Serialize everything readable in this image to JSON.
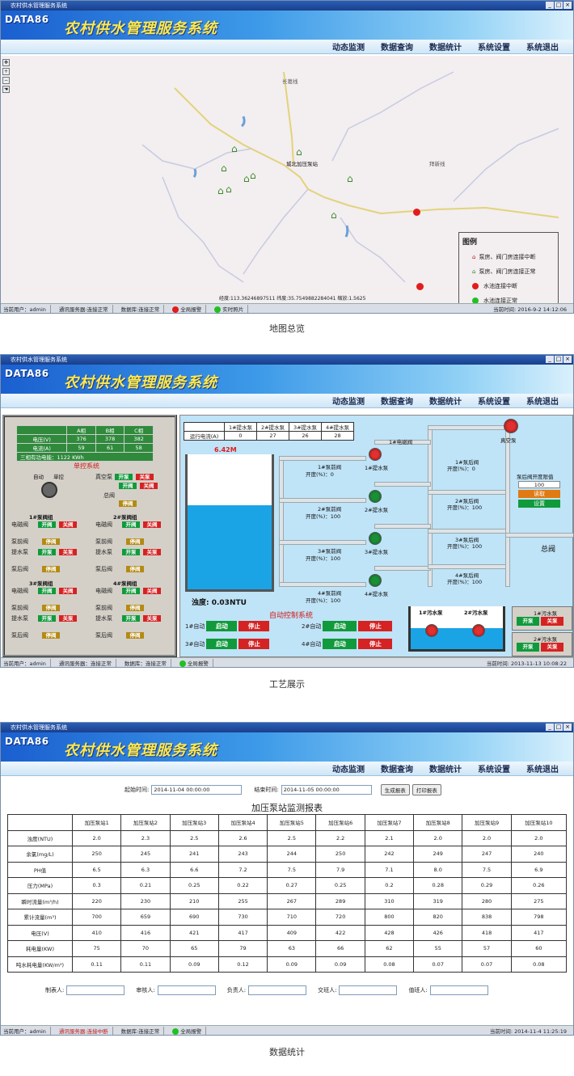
{
  "app": {
    "title": "农村供水管理服务系统",
    "brand": "农村供水管理服务系统",
    "logo": "DATA86",
    "window_title": "农村供水管理服务系统"
  },
  "menu": [
    "动态监测",
    "数据查询",
    "数据统计",
    "系统设置",
    "系统退出"
  ],
  "map": {
    "road_labels": [
      "长葛线",
      "城北加压泵站",
      "拜新线"
    ],
    "legend_title": "图例",
    "legend_items": [
      "泵房、阀门房连接中断",
      "泵房、阀门房连接正常",
      "水池连接中断",
      "水池连接正常"
    ],
    "coords": "经度:113.36246897511 纬度:35.7549882284041 缩放:1.5625",
    "status": {
      "user": "当前用户：admin",
      "comm": "通讯服务器:连接正常",
      "db": "数据库:连接正常",
      "alarm": "全局报警",
      "photo": "实时照片",
      "time": "当前时间: 2016-9-2 14:12:06"
    }
  },
  "map_caption": "地图总览",
  "process": {
    "power_table": {
      "headers": [
        "",
        "A相",
        "B相",
        "C相"
      ],
      "rows": [
        [
          "电压(V)",
          "376",
          "378",
          "382"
        ],
        [
          "电流(A)",
          "59",
          "61",
          "58"
        ]
      ],
      "footer": "三相有功电能：1122 KWh"
    },
    "single_title": "单控系统",
    "auto": "自动",
    "single": "单控",
    "vacuum": "真空泵",
    "total_valve": "总阀",
    "groups": [
      {
        "title": "1#泵阀组",
        "rows": [
          "电磁阀",
          "泵前阀",
          "提水泵",
          "泵后阀"
        ]
      },
      {
        "title": "2#泵阀组",
        "rows": [
          "电磁阀",
          "泵前阀",
          "提水泵",
          "泵后阀"
        ]
      },
      {
        "title": "3#泵阀组",
        "rows": [
          "电磁阀",
          "泵前阀",
          "提水泵",
          "泵后阀"
        ]
      },
      {
        "title": "4#泵阀组",
        "rows": [
          "电磁阀",
          "泵前阀",
          "提水泵",
          "泵后阀"
        ]
      }
    ],
    "btn_open": "开阀",
    "btn_close": "关阀",
    "btn_pump_open": "开泵",
    "btn_pump_close": "关泵",
    "btn_stop": "停阀",
    "current_table": {
      "headers": [
        "",
        "1#提水泵",
        "2#提水泵",
        "3#提水泵",
        "4#提水泵"
      ],
      "row_label": "运行电流(A)",
      "values": [
        "0",
        "27",
        "26",
        "28"
      ]
    },
    "tank_level": "6.42M",
    "tank_level_pct": 0.62,
    "turbidity": "浊度: 0.03NTU",
    "auto_control_title": "自动控制系统",
    "auto_groups": [
      "1#自动",
      "2#自动",
      "3#自动",
      "4#自动"
    ],
    "btn_start": "启动",
    "btn_halt": "停止",
    "pump_labels": [
      "1#提水泵",
      "2#提水泵",
      "3#提水泵",
      "4#提水泵"
    ],
    "valve_labels": [
      "1#泵前阀",
      "2#泵前阀",
      "3#泵前阀",
      "4#泵前阀",
      "1#泵后阀",
      "2#泵后阀",
      "3#泵后阀",
      "4#泵后阀",
      "1#电磁阀"
    ],
    "open_pct": [
      "开度(%)：0",
      "开度(%)：100",
      "开度(%)：100",
      "开度(%)：100",
      "开度(%)：0",
      "开度(%)：100",
      "开度(%)：100",
      "开度(%)：100"
    ],
    "vacuum_pump": "真空泵",
    "rear_valve_title": "泵后阀开度限值",
    "rear_value": "100",
    "btn_read": "读取",
    "btn_set": "设置",
    "main_valve": "总阀",
    "sewage": [
      "1#污水泵",
      "2#污水泵"
    ],
    "sewage_ctrl": [
      "1#污水泵",
      "2#污水泵"
    ],
    "status": {
      "user": "当前用户：admin",
      "comm": "通讯服务器：连接正常",
      "db": "数据库：连接正常",
      "alarm": "全局报警",
      "time": "当前时间: 2013-11-13 10:08:22"
    }
  },
  "process_caption": "工艺展示",
  "report": {
    "start_label": "起始时间:",
    "start_value": "2014-11-04 00:00:00",
    "end_label": "结束时间:",
    "end_value": "2014-11-05 00:00:00",
    "btn_generate": "生成报表",
    "btn_print": "打印报表",
    "title": "加压泵站监测报表",
    "columns": [
      "",
      "加压泵站1",
      "加压泵站2",
      "加压泵站3",
      "加压泵站4",
      "加压泵站5",
      "加压泵站6",
      "加压泵站7",
      "加压泵站8",
      "加压泵站9",
      "加压泵站10"
    ],
    "rows": [
      [
        "浊度(NTU)",
        "2.0",
        "2.3",
        "2.5",
        "2.6",
        "2.5",
        "2.2",
        "2.1",
        "2.0",
        "2.0",
        "2.0"
      ],
      [
        "余氯(mg/L)",
        "250",
        "245",
        "241",
        "243",
        "244",
        "250",
        "242",
        "249",
        "247",
        "240"
      ],
      [
        "PH值",
        "6.5",
        "6.3",
        "6.6",
        "7.2",
        "7.5",
        "7.9",
        "7.1",
        "8.0",
        "7.5",
        "6.9"
      ],
      [
        "压力(MPa)",
        "0.3",
        "0.21",
        "0.25",
        "0.22",
        "0.27",
        "0.25",
        "0.2",
        "0.28",
        "0.29",
        "0.26"
      ],
      [
        "瞬时流量(m³/h)",
        "220",
        "230",
        "210",
        "255",
        "267",
        "289",
        "310",
        "319",
        "280",
        "275"
      ],
      [
        "累计流量(m³)",
        "700",
        "659",
        "690",
        "730",
        "710",
        "720",
        "800",
        "820",
        "838",
        "798"
      ],
      [
        "电压(V)",
        "410",
        "416",
        "421",
        "417",
        "409",
        "422",
        "428",
        "426",
        "418",
        "417"
      ],
      [
        "耗电量(KW)",
        "75",
        "70",
        "65",
        "79",
        "63",
        "66",
        "62",
        "55",
        "57",
        "60"
      ],
      [
        "吨水耗电量(KW/m³)",
        "0.11",
        "0.11",
        "0.09",
        "0.12",
        "0.09",
        "0.09",
        "0.08",
        "0.07",
        "0.07",
        "0.08"
      ]
    ],
    "signatures": [
      "制表人:",
      "审核人:",
      "负责人:",
      "交班人:",
      "值班人:"
    ],
    "status": {
      "user": "当前用户：admin",
      "comm": "通讯服务器:连接中断",
      "db": "数据库:连接正常",
      "alarm": "全局报警",
      "time": "当前时间: 2014-11-4 11:25:19"
    }
  },
  "report_caption": "数据统计",
  "colors": {
    "accent": "#1a5fd0",
    "brand_text": "#ffe94a",
    "ok_green": "#10a23a",
    "err_red": "#d52222"
  }
}
